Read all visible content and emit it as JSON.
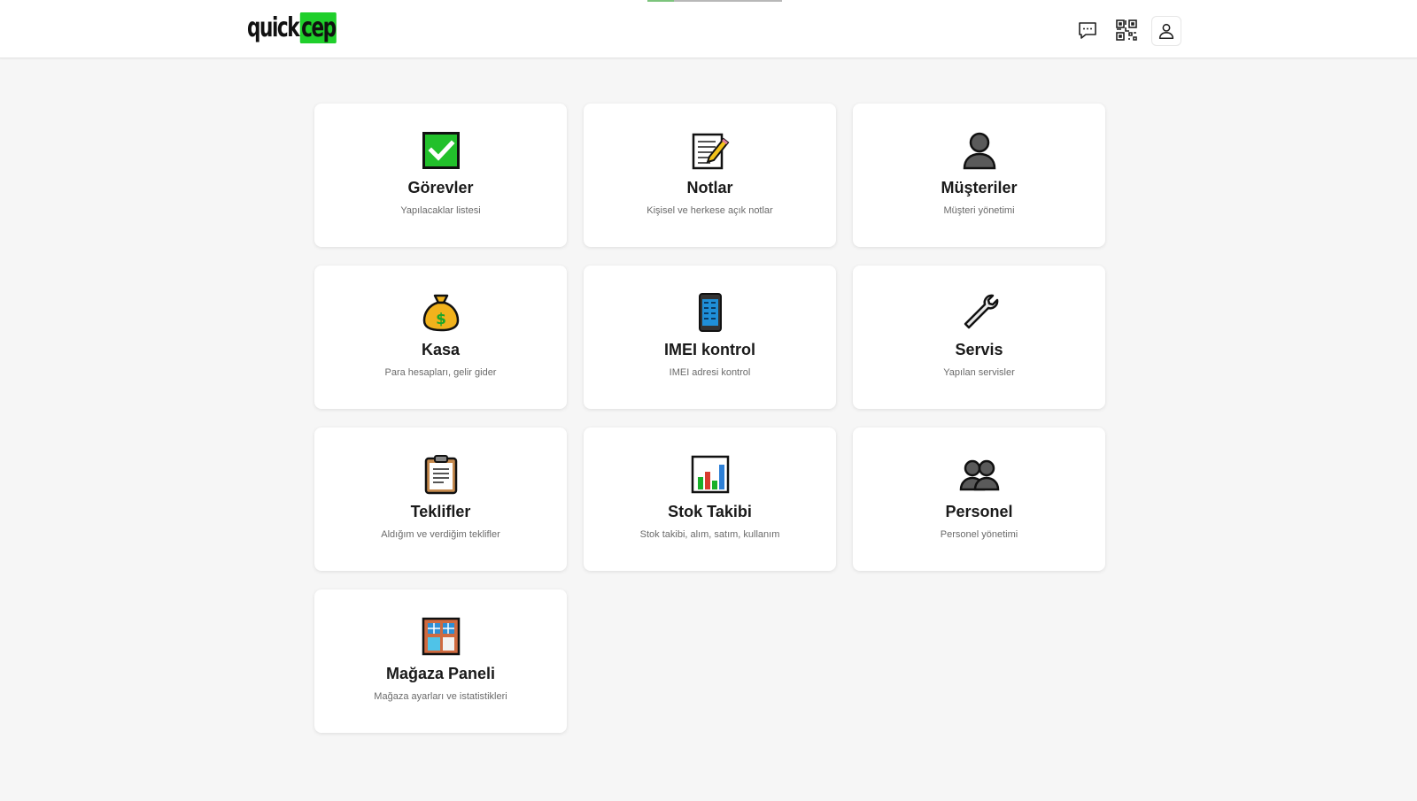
{
  "header": {
    "logo": {
      "word1": "quick",
      "word2": "cep"
    },
    "icons": [
      "chat-icon",
      "qr-code-icon",
      "user-icon"
    ]
  },
  "modules": [
    {
      "title": "Görevler",
      "subtitle": "Yapılacaklar listesi",
      "icon": "checkbox-icon"
    },
    {
      "title": "Notlar",
      "subtitle": "Kişisel ve herkese açık notlar",
      "icon": "memo-icon"
    },
    {
      "title": "Müşteriler",
      "subtitle": "Müşteri yönetimi",
      "icon": "person-icon"
    },
    {
      "title": "Kasa",
      "subtitle": "Para hesapları, gelir gider",
      "icon": "money-bag-icon"
    },
    {
      "title": "IMEI kontrol",
      "subtitle": "IMEI adresi kontrol",
      "icon": "mobile-phone-icon"
    },
    {
      "title": "Servis",
      "subtitle": "Yapılan servisler",
      "icon": "wrench-icon"
    },
    {
      "title": "Teklifler",
      "subtitle": "Aldığım ve verdiğim teklifler",
      "icon": "clipboard-icon"
    },
    {
      "title": "Stok Takibi",
      "subtitle": "Stok takibi, alım, satım, kullanım",
      "icon": "bar-chart-icon"
    },
    {
      "title": "Personel",
      "subtitle": "Personel yönetimi",
      "icon": "people-icon"
    },
    {
      "title": "Mağaza Paneli",
      "subtitle": "Mağaza ayarları ve istatistikleri",
      "icon": "department-store-icon"
    }
  ],
  "colors": {
    "accent_green": "#1fcf2b",
    "page_background": "#f6f6f6",
    "card_background": "#ffffff",
    "subtitle_text": "#6a6a6a"
  }
}
